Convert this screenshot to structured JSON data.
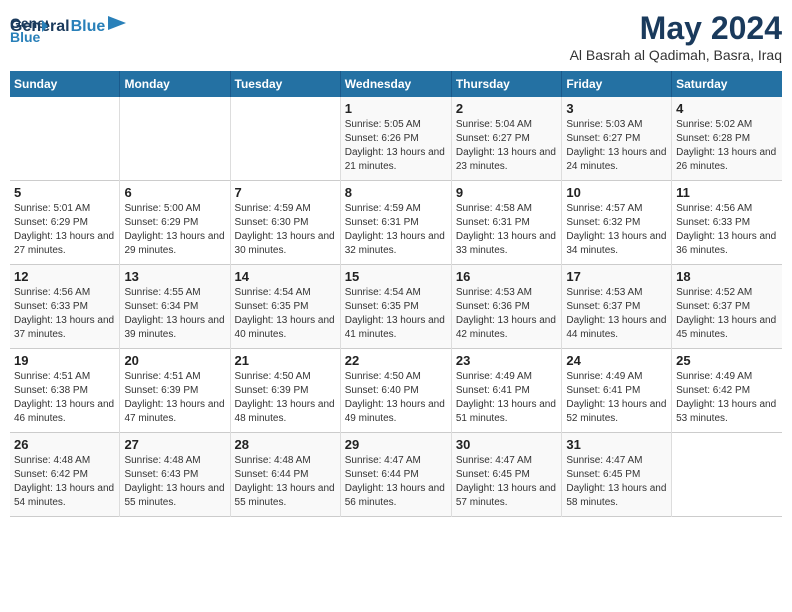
{
  "logo": {
    "line1": "General",
    "line2": "Blue"
  },
  "title": "May 2024",
  "subtitle": "Al Basrah al Qadimah, Basra, Iraq",
  "days_of_week": [
    "Sunday",
    "Monday",
    "Tuesday",
    "Wednesday",
    "Thursday",
    "Friday",
    "Saturday"
  ],
  "weeks": [
    [
      {
        "day": "",
        "info": ""
      },
      {
        "day": "",
        "info": ""
      },
      {
        "day": "",
        "info": ""
      },
      {
        "day": "1",
        "info": "Sunrise: 5:05 AM\nSunset: 6:26 PM\nDaylight: 13 hours and 21 minutes."
      },
      {
        "day": "2",
        "info": "Sunrise: 5:04 AM\nSunset: 6:27 PM\nDaylight: 13 hours and 23 minutes."
      },
      {
        "day": "3",
        "info": "Sunrise: 5:03 AM\nSunset: 6:27 PM\nDaylight: 13 hours and 24 minutes."
      },
      {
        "day": "4",
        "info": "Sunrise: 5:02 AM\nSunset: 6:28 PM\nDaylight: 13 hours and 26 minutes."
      }
    ],
    [
      {
        "day": "5",
        "info": "Sunrise: 5:01 AM\nSunset: 6:29 PM\nDaylight: 13 hours and 27 minutes."
      },
      {
        "day": "6",
        "info": "Sunrise: 5:00 AM\nSunset: 6:29 PM\nDaylight: 13 hours and 29 minutes."
      },
      {
        "day": "7",
        "info": "Sunrise: 4:59 AM\nSunset: 6:30 PM\nDaylight: 13 hours and 30 minutes."
      },
      {
        "day": "8",
        "info": "Sunrise: 4:59 AM\nSunset: 6:31 PM\nDaylight: 13 hours and 32 minutes."
      },
      {
        "day": "9",
        "info": "Sunrise: 4:58 AM\nSunset: 6:31 PM\nDaylight: 13 hours and 33 minutes."
      },
      {
        "day": "10",
        "info": "Sunrise: 4:57 AM\nSunset: 6:32 PM\nDaylight: 13 hours and 34 minutes."
      },
      {
        "day": "11",
        "info": "Sunrise: 4:56 AM\nSunset: 6:33 PM\nDaylight: 13 hours and 36 minutes."
      }
    ],
    [
      {
        "day": "12",
        "info": "Sunrise: 4:56 AM\nSunset: 6:33 PM\nDaylight: 13 hours and 37 minutes."
      },
      {
        "day": "13",
        "info": "Sunrise: 4:55 AM\nSunset: 6:34 PM\nDaylight: 13 hours and 39 minutes."
      },
      {
        "day": "14",
        "info": "Sunrise: 4:54 AM\nSunset: 6:35 PM\nDaylight: 13 hours and 40 minutes."
      },
      {
        "day": "15",
        "info": "Sunrise: 4:54 AM\nSunset: 6:35 PM\nDaylight: 13 hours and 41 minutes."
      },
      {
        "day": "16",
        "info": "Sunrise: 4:53 AM\nSunset: 6:36 PM\nDaylight: 13 hours and 42 minutes."
      },
      {
        "day": "17",
        "info": "Sunrise: 4:53 AM\nSunset: 6:37 PM\nDaylight: 13 hours and 44 minutes."
      },
      {
        "day": "18",
        "info": "Sunrise: 4:52 AM\nSunset: 6:37 PM\nDaylight: 13 hours and 45 minutes."
      }
    ],
    [
      {
        "day": "19",
        "info": "Sunrise: 4:51 AM\nSunset: 6:38 PM\nDaylight: 13 hours and 46 minutes."
      },
      {
        "day": "20",
        "info": "Sunrise: 4:51 AM\nSunset: 6:39 PM\nDaylight: 13 hours and 47 minutes."
      },
      {
        "day": "21",
        "info": "Sunrise: 4:50 AM\nSunset: 6:39 PM\nDaylight: 13 hours and 48 minutes."
      },
      {
        "day": "22",
        "info": "Sunrise: 4:50 AM\nSunset: 6:40 PM\nDaylight: 13 hours and 49 minutes."
      },
      {
        "day": "23",
        "info": "Sunrise: 4:49 AM\nSunset: 6:41 PM\nDaylight: 13 hours and 51 minutes."
      },
      {
        "day": "24",
        "info": "Sunrise: 4:49 AM\nSunset: 6:41 PM\nDaylight: 13 hours and 52 minutes."
      },
      {
        "day": "25",
        "info": "Sunrise: 4:49 AM\nSunset: 6:42 PM\nDaylight: 13 hours and 53 minutes."
      }
    ],
    [
      {
        "day": "26",
        "info": "Sunrise: 4:48 AM\nSunset: 6:42 PM\nDaylight: 13 hours and 54 minutes."
      },
      {
        "day": "27",
        "info": "Sunrise: 4:48 AM\nSunset: 6:43 PM\nDaylight: 13 hours and 55 minutes."
      },
      {
        "day": "28",
        "info": "Sunrise: 4:48 AM\nSunset: 6:44 PM\nDaylight: 13 hours and 55 minutes."
      },
      {
        "day": "29",
        "info": "Sunrise: 4:47 AM\nSunset: 6:44 PM\nDaylight: 13 hours and 56 minutes."
      },
      {
        "day": "30",
        "info": "Sunrise: 4:47 AM\nSunset: 6:45 PM\nDaylight: 13 hours and 57 minutes."
      },
      {
        "day": "31",
        "info": "Sunrise: 4:47 AM\nSunset: 6:45 PM\nDaylight: 13 hours and 58 minutes."
      },
      {
        "day": "",
        "info": ""
      }
    ]
  ]
}
